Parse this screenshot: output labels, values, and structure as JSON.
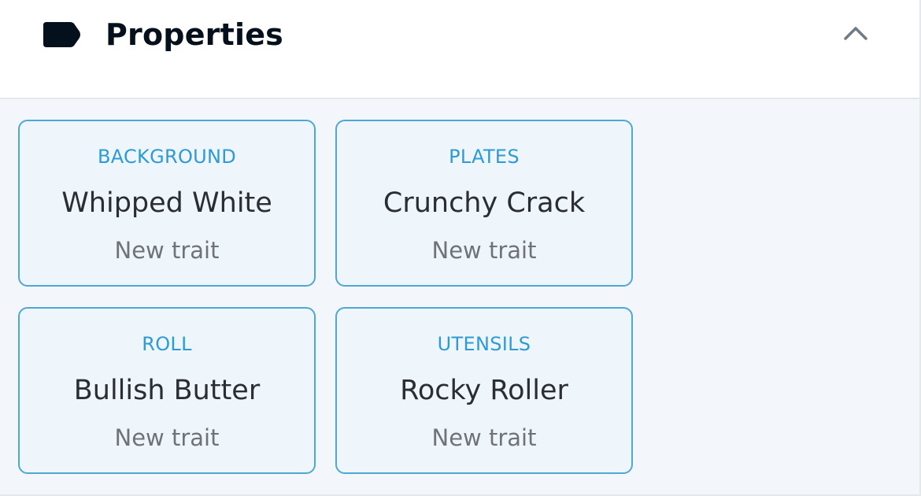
{
  "header": {
    "title": "Properties",
    "icon": "tag-icon",
    "collapse_icon": "chevron-up-icon"
  },
  "colors": {
    "accent": "#2e9bd6",
    "card_border": "#4ea8d3",
    "card_background": "#eef5fb",
    "title_text": "#04111d"
  },
  "traits": [
    {
      "type": "BACKGROUND",
      "value": "Whipped White",
      "rarity": "New trait"
    },
    {
      "type": "PLATES",
      "value": "Crunchy Crack",
      "rarity": "New trait"
    },
    {
      "type": "ROLL",
      "value": "Bullish Butter",
      "rarity": "New trait"
    },
    {
      "type": "UTENSILS",
      "value": "Rocky Roller",
      "rarity": "New trait"
    }
  ]
}
